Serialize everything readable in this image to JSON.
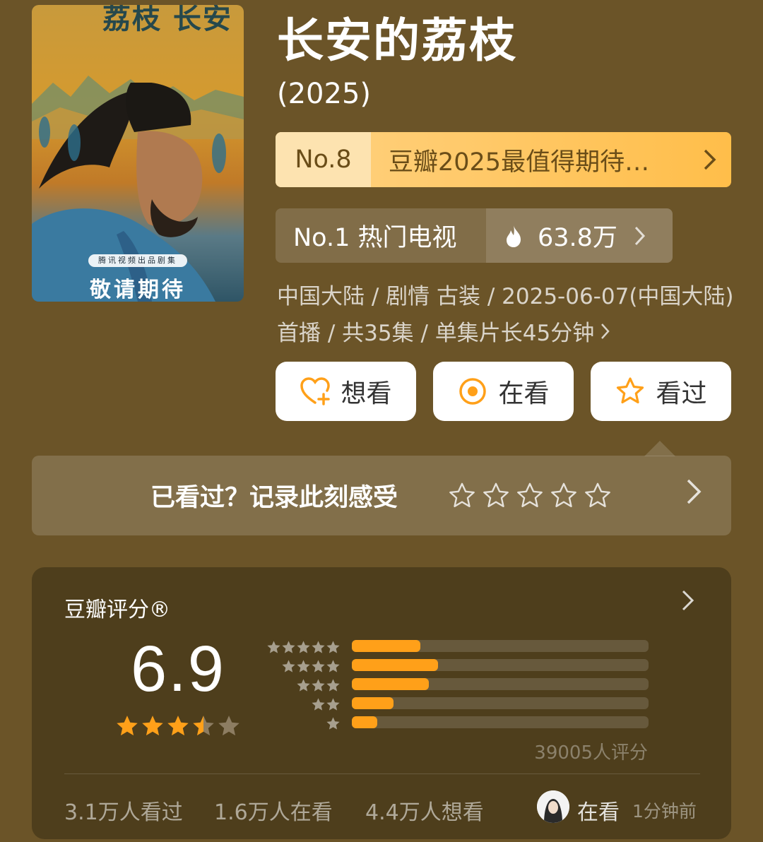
{
  "poster": {
    "title_art": "荔枝 长安",
    "producer_badge": "腾讯视频出品剧集",
    "coming_soon": "敬请期待"
  },
  "header": {
    "title": "长安的荔枝",
    "year": "(2025)"
  },
  "rankings": {
    "primary": {
      "rank": "No.8",
      "label": "豆瓣2025最值得期待…",
      "chevron": ">"
    },
    "secondary": {
      "label": "No.1 热门电视",
      "heat": "63.8万",
      "chevron": ">",
      "icon": "flame-icon"
    }
  },
  "meta": {
    "text": "中国大陆 / 剧情 古装 / 2025-06-07(中国大陆)首播 / 共35集 / 单集片长45分钟",
    "chevron": ">"
  },
  "actions": [
    {
      "label": "想看",
      "icon": "heart-plus-icon"
    },
    {
      "label": "在看",
      "icon": "target-circle-icon"
    },
    {
      "label": "看过",
      "icon": "star-outline-icon"
    }
  ],
  "record": {
    "prompt": "已看过？记录此刻感受",
    "star_count": 5,
    "chevron": ">"
  },
  "rating": {
    "title": "豆瓣评分®",
    "chevron": ">",
    "score": "6.9",
    "stars_value": 3.5,
    "distribution": [
      {
        "stars": 5,
        "fraction": 0.23
      },
      {
        "stars": 4,
        "fraction": 0.29
      },
      {
        "stars": 3,
        "fraction": 0.26
      },
      {
        "stars": 2,
        "fraction": 0.14
      },
      {
        "stars": 1,
        "fraction": 0.085
      }
    ],
    "count_text": "39005人评分"
  },
  "stats": {
    "watched": "3.1万人看过",
    "watching": "1.6万人在看",
    "want": "4.4万人想看"
  },
  "activity": {
    "status": "在看",
    "time": "1分钟前"
  },
  "colors": {
    "background": "#6b5428",
    "accent_orange": "#ffa019",
    "rank_gold": "#ffbe4a"
  }
}
